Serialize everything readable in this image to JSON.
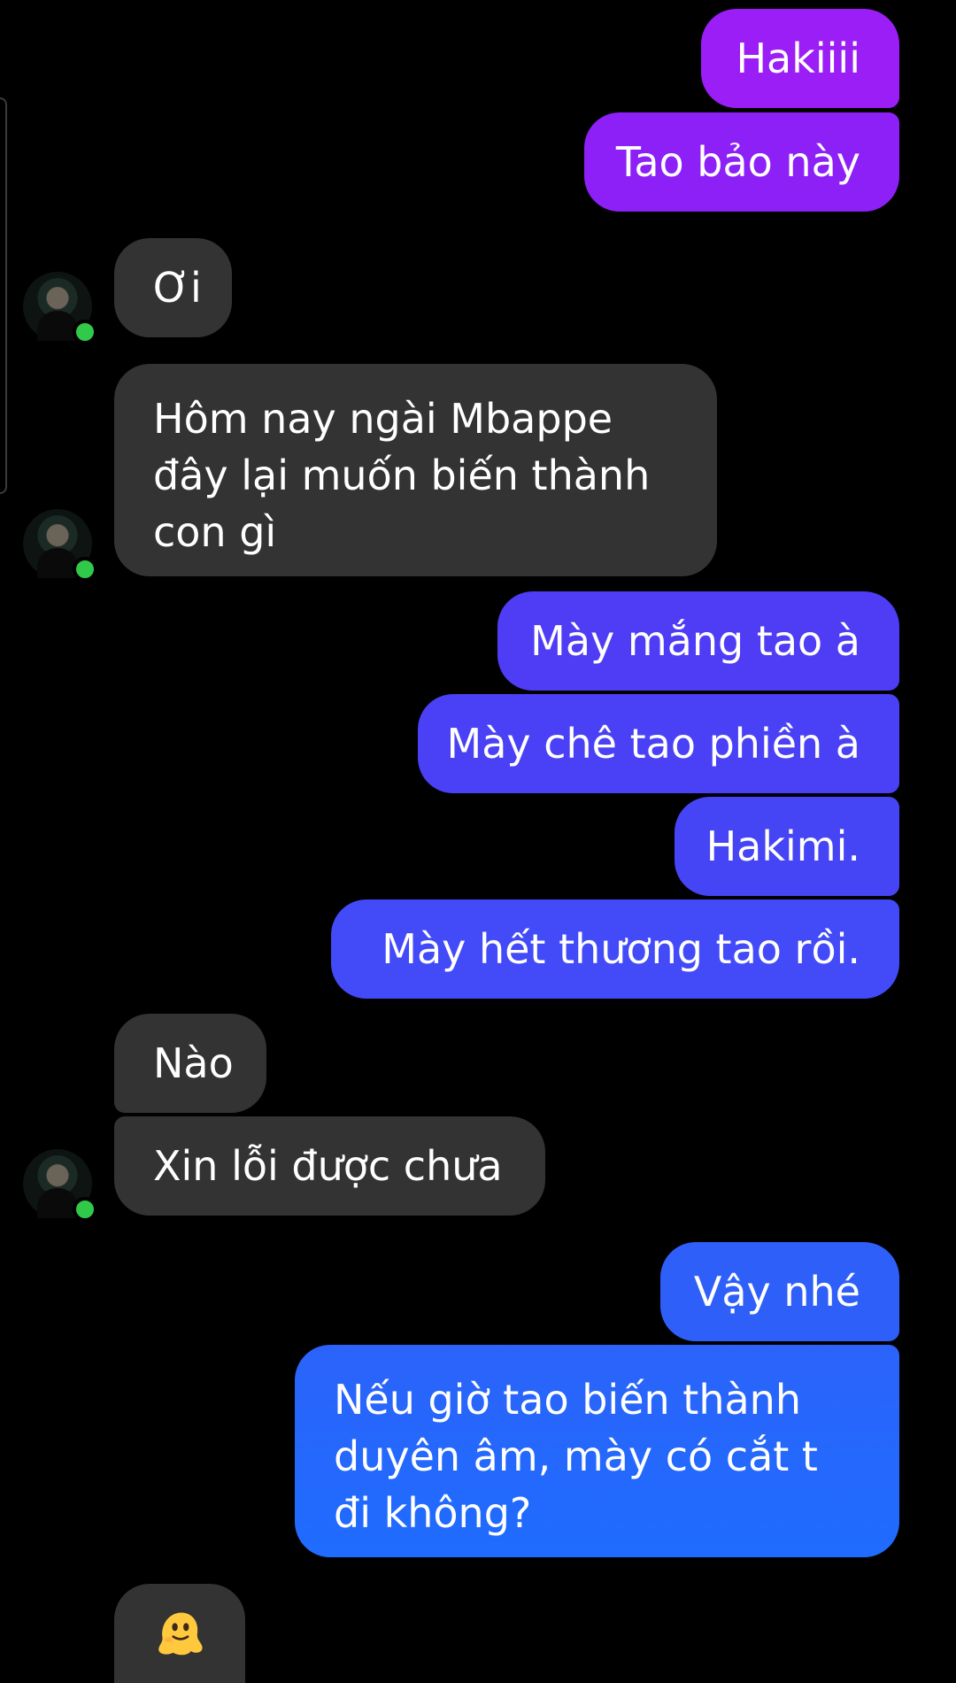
{
  "messages": [
    {
      "side": "out",
      "text": "Hakiiii"
    },
    {
      "side": "out",
      "text": "Tao bảo này"
    },
    {
      "side": "in",
      "text": "Ơi"
    },
    {
      "side": "in",
      "text": "Hôm nay ngài Mbappe đây lại muốn biến thành con gì"
    },
    {
      "side": "out",
      "text": "Mày mắng tao à"
    },
    {
      "side": "out",
      "text": "Mày chê tao phiền à"
    },
    {
      "side": "out",
      "text": "Hakimi."
    },
    {
      "side": "out",
      "text": "Mày hết thương tao rồi."
    },
    {
      "side": "in",
      "text": "Nào"
    },
    {
      "side": "in",
      "text": "Xin lỗi được chưa"
    },
    {
      "side": "out",
      "text": "Vậy nhé"
    },
    {
      "side": "out",
      "text": "Nếu giờ tao biến thành duyên âm, mày có cắt t đi không?"
    },
    {
      "side": "in",
      "text": "",
      "emoji": "melting-face-emoji"
    }
  ],
  "contact": {
    "status": "online",
    "avatar_icon": "profile-photo"
  },
  "colors": {
    "background": "#000000",
    "incoming_bubble": "#333333",
    "outgoing_gradient_top": "#9a1ef5",
    "outgoing_gradient_bottom": "#1f6cff",
    "online_dot": "#31c94a",
    "text": "#ffffff"
  }
}
